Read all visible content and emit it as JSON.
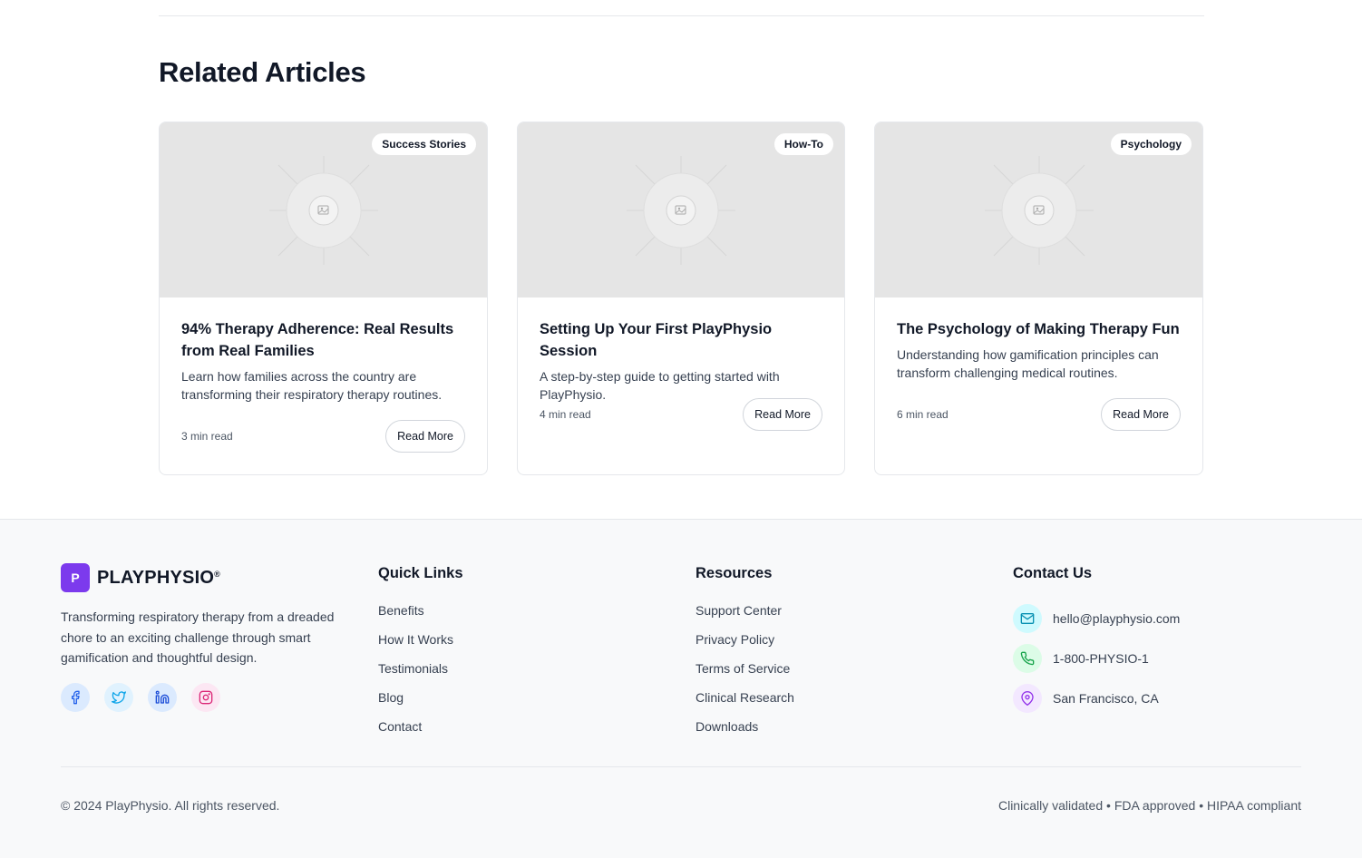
{
  "related": {
    "title": "Related Articles",
    "cards": [
      {
        "tag": "Success Stories",
        "title": "94% Therapy Adherence: Real Results from Real Families",
        "description": "Learn how families across the country are transforming their respiratory therapy routines.",
        "read_time": "3 min read",
        "button": "Read More"
      },
      {
        "tag": "How-To",
        "title": "Setting Up Your First PlayPhysio Session",
        "description": "A step-by-step guide to getting started with PlayPhysio.",
        "read_time": "4 min read",
        "button": "Read More"
      },
      {
        "tag": "Psychology",
        "title": "The Psychology of Making Therapy Fun",
        "description": "Understanding how gamification principles can transform challenging medical routines.",
        "read_time": "6 min read",
        "button": "Read More"
      }
    ]
  },
  "footer": {
    "logo_letter": "P",
    "brand_name": "PLAYPHYSIO",
    "brand_mark": "®",
    "description": "Transforming respiratory therapy from a dreaded chore to an exciting challenge through smart gamification and thoughtful design.",
    "socials": [
      {
        "icon": "facebook-icon",
        "color": "#2563eb",
        "bg": "#dbeafe"
      },
      {
        "icon": "twitter-icon",
        "color": "#0ea5e9",
        "bg": "#e0f2fe"
      },
      {
        "icon": "linkedin-icon",
        "color": "#1d4ed8",
        "bg": "#dbeafe"
      },
      {
        "icon": "instagram-icon",
        "color": "#db2777",
        "bg": "#fce7f3"
      }
    ],
    "quick_links": {
      "title": "Quick Links",
      "items": [
        "Benefits",
        "How It Works",
        "Testimonials",
        "Blog",
        "Contact"
      ]
    },
    "resources": {
      "title": "Resources",
      "items": [
        "Support Center",
        "Privacy Policy",
        "Terms of Service",
        "Clinical Research",
        "Downloads"
      ]
    },
    "contact": {
      "title": "Contact Us",
      "items": [
        {
          "icon": "mail-icon",
          "text": "hello@playphysio.com",
          "color": "#0891b2",
          "bg": "#cffafe"
        },
        {
          "icon": "phone-icon",
          "text": "1-800-PHYSIO-1",
          "color": "#16a34a",
          "bg": "#dcfce7"
        },
        {
          "icon": "map-pin-icon",
          "text": "San Francisco, CA",
          "color": "#9333ea",
          "bg": "#f3e8ff"
        }
      ]
    },
    "copyright": "© 2024 PlayPhysio. All rights reserved.",
    "compliance": "Clinically validated • FDA approved • HIPAA compliant"
  },
  "colors": {
    "brand": "#7c3aed",
    "card_image_bg": "#e5e5e5",
    "footer_bg": "#f8f9fa"
  }
}
